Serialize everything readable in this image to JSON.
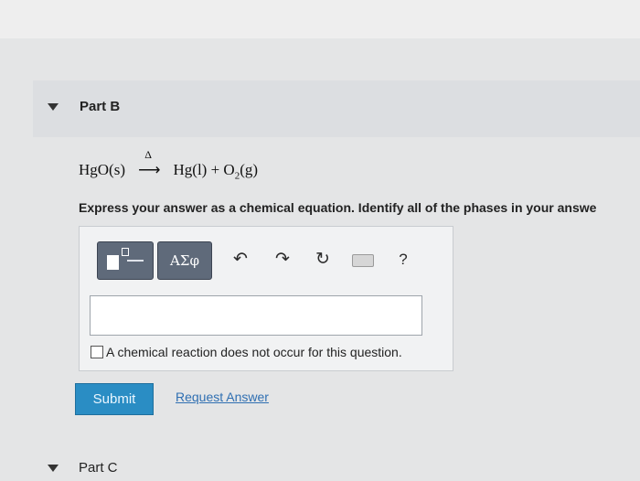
{
  "part_b": {
    "title": "Part B"
  },
  "equation": {
    "reactant": "HgO(s)",
    "condition": "Δ",
    "arrow": "⟶",
    "product_1": "Hg(l)",
    "plus": "+",
    "product_2_prefix": "O",
    "product_2_subscript": "2",
    "product_2_suffix": "(g)"
  },
  "prompt": "Express your answer as a chemical equation. Identify all of the phases in your answe",
  "toolbar": {
    "greek_label": "ΑΣφ",
    "undo_glyph": "↶",
    "redo_glyph": "↷",
    "reset_glyph": "↻",
    "help_label": "?"
  },
  "answer_input": {
    "value": ""
  },
  "no_reaction": {
    "label": "A chemical reaction does not occur for this question.",
    "checked": false
  },
  "actions": {
    "submit_label": "Submit",
    "request_label": "Request Answer"
  },
  "part_c": {
    "title": "Part C"
  },
  "colors": {
    "submit": "#2a8dc4",
    "link": "#2f6fb2",
    "toolbar_button": "#5f6a7a"
  }
}
